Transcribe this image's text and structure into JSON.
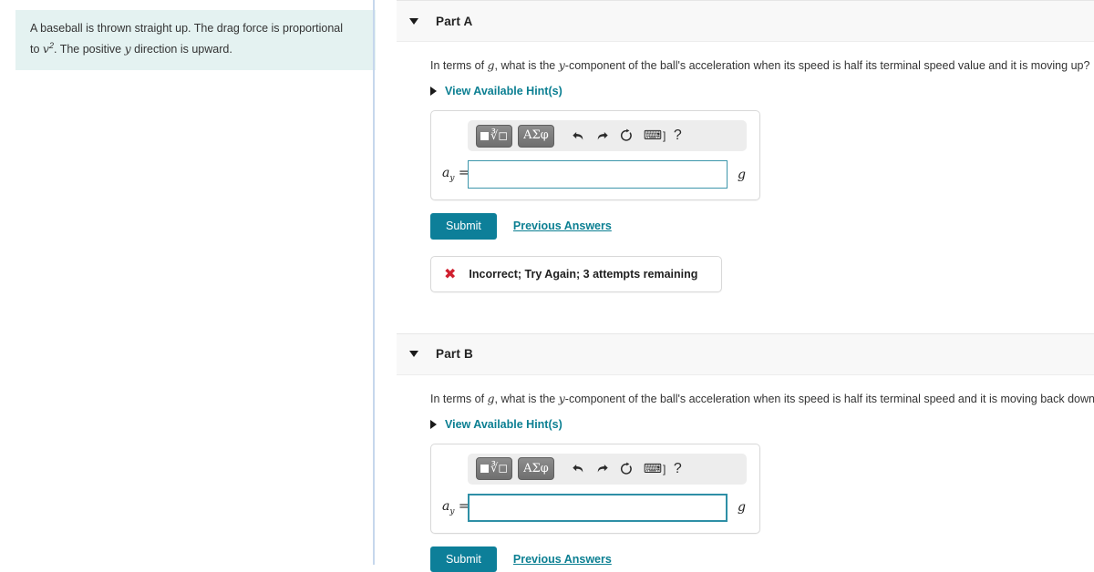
{
  "problem": {
    "intro_line1": "A baseball is thrown straight up. The drag force is proportional",
    "intro_line2_pre": "to ",
    "intro_var": "v",
    "intro_exp": "2",
    "intro_line2_post": ". The positive ",
    "intro_var2": "y",
    "intro_line2_end": " direction is upward.",
    "background_color": "#e4f2f1"
  },
  "theme": {
    "accent": "#0d7f99",
    "link": "#0b7f92",
    "input_border": "#3d96ab",
    "error": "#d0202f",
    "header_band": "#f8f8f8",
    "divider": "#c6d7ec"
  },
  "parts": [
    {
      "id": "part-a",
      "title": "Part A",
      "caret": "caret-down",
      "question_pre": "In terms of ",
      "question_var_g": "g",
      "question_mid": ", what is the ",
      "question_var_y": "y",
      "question_post": "-component of the ball's acceleration when its speed is half its terminal speed value and it is moving up?",
      "hint_label": "View Available Hint(s)",
      "toolbar": {
        "template_button": "template-square-root",
        "greek_button": "ΑΣφ",
        "undo": "⬅",
        "redo": "➡",
        "reset": "⟳",
        "keyboard": "⌨",
        "keyboard_bracket": "]",
        "help": "?"
      },
      "answer": {
        "variable": "a",
        "subscript": "y",
        "equals": "=",
        "value": "",
        "placeholder": "",
        "unit": "g",
        "focused": false
      },
      "submit_label": "Submit",
      "previous_answers_label": "Previous Answers",
      "feedback": {
        "icon": "✖",
        "text": "Incorrect; Try Again; 3 attempts remaining",
        "visible": true
      }
    },
    {
      "id": "part-b",
      "title": "Part B",
      "caret": "caret-down",
      "question_pre": "In terms of ",
      "question_var_g": "g",
      "question_mid": ", what is the ",
      "question_var_y": "y",
      "question_post": "-component of the ball's acceleration when its speed is half its terminal speed and it is moving back down?",
      "hint_label": "View Available Hint(s)",
      "toolbar": {
        "template_button": "template-square-root",
        "greek_button": "ΑΣφ",
        "undo": "⬅",
        "redo": "➡",
        "reset": "⟳",
        "keyboard": "⌨",
        "keyboard_bracket": "]",
        "help": "?"
      },
      "answer": {
        "variable": "a",
        "subscript": "y",
        "equals": "=",
        "value": "",
        "placeholder": "",
        "unit": "g",
        "focused": true
      },
      "submit_label": "Submit",
      "previous_answers_label": "Previous Answers",
      "feedback": {
        "icon": "",
        "text": "",
        "visible": false
      }
    }
  ]
}
